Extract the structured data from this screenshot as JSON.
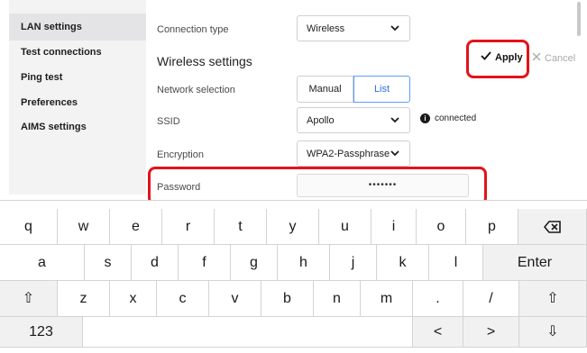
{
  "sidebar": {
    "items": [
      {
        "label": "LAN settings",
        "active": true
      },
      {
        "label": "Test connections",
        "active": false
      },
      {
        "label": "Ping test",
        "active": false
      },
      {
        "label": "Preferences",
        "active": false
      },
      {
        "label": "AIMS settings",
        "active": false
      }
    ]
  },
  "form": {
    "connection_type_label": "Connection type",
    "connection_type_value": "Wireless",
    "section_title": "Wireless settings",
    "network_selection_label": "Network selection",
    "network_options": [
      "Manual",
      "List"
    ],
    "network_selected": "List",
    "ssid_label": "SSID",
    "ssid_value": "Apollo",
    "ssid_status": "connected",
    "encryption_label": "Encryption",
    "encryption_value": "WPA2-Passphrase",
    "password_label": "Password",
    "password_value": "•••••••"
  },
  "actions": {
    "apply_label": "Apply",
    "cancel_label": "Cancel"
  },
  "keyboard": {
    "row1": [
      "q",
      "w",
      "e",
      "r",
      "t",
      "y",
      "u",
      "i",
      "o",
      "p",
      "⌫"
    ],
    "row2": [
      "a",
      "s",
      "d",
      "f",
      "g",
      "h",
      "j",
      "k",
      "l",
      "Enter"
    ],
    "row3": [
      "⇧",
      "z",
      "x",
      "c",
      "v",
      "b",
      "n",
      "m",
      ".",
      "/",
      "⇧"
    ],
    "row4": [
      "123",
      "",
      "<",
      ">",
      "⇩"
    ]
  },
  "colors": {
    "highlight": "#e3131b",
    "selected_accent": "#2c6fe0",
    "sidebar_bg": "#f3f3f4"
  }
}
